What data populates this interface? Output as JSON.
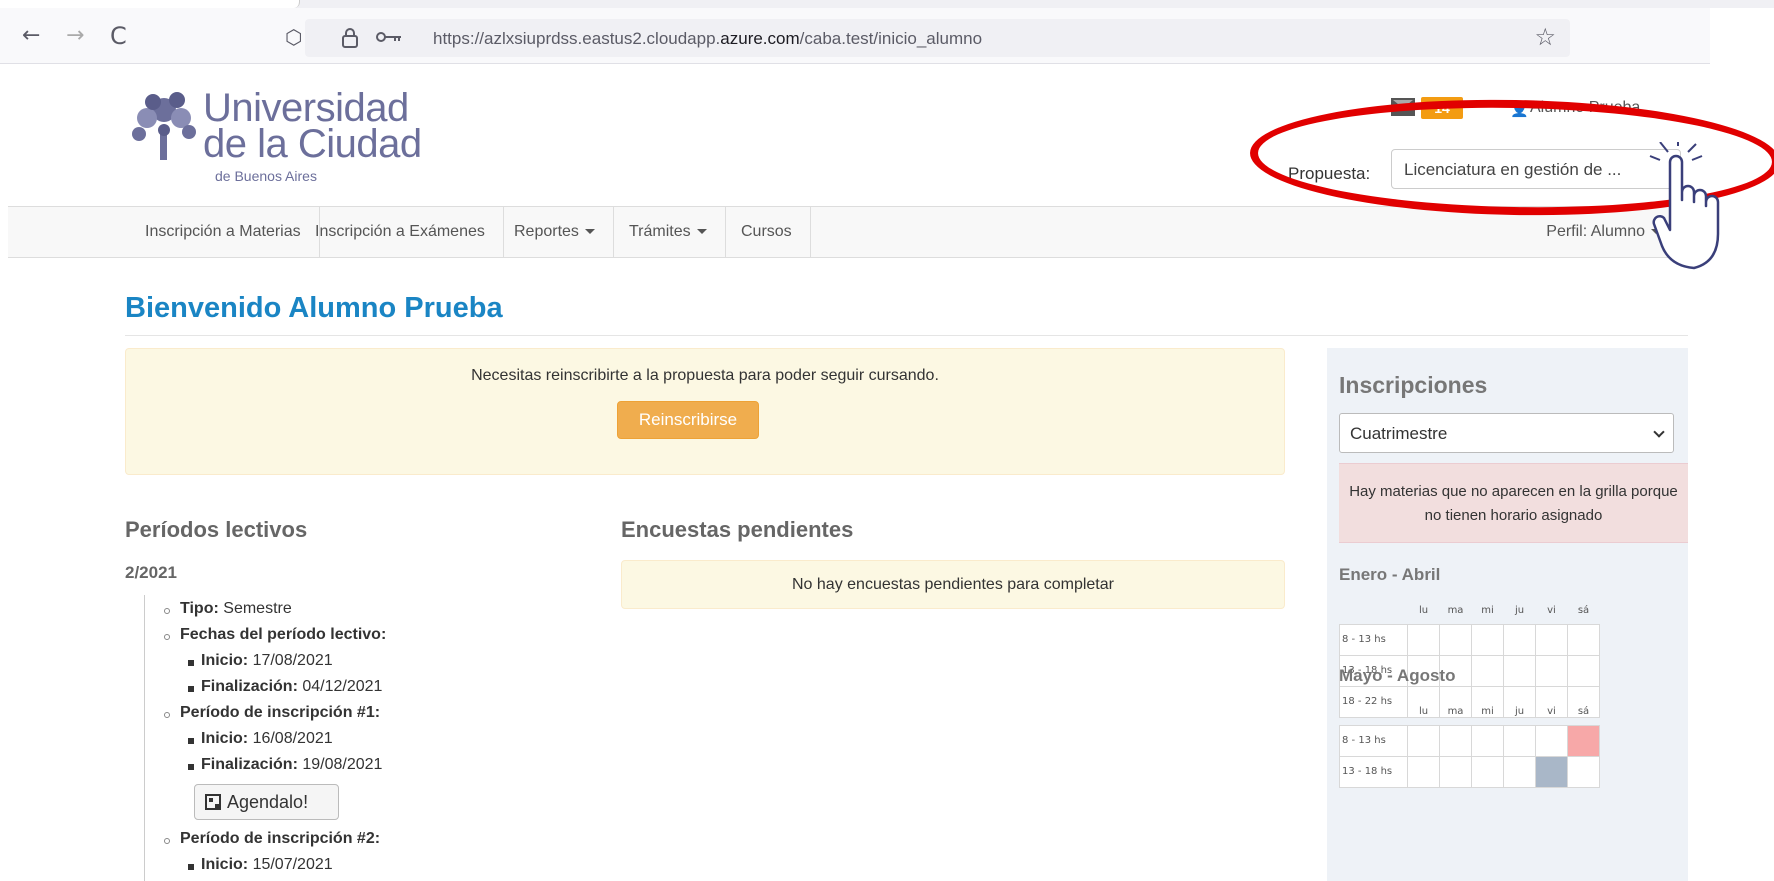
{
  "browser": {
    "back": "←",
    "forward": "→",
    "reload": "C",
    "shield": "⬡",
    "lock": "🔒",
    "key": "⚿",
    "url_prefix": "https://azlxsiuprdss.eastus2.cloudapp.",
    "url_domain": "azure.com",
    "url_suffix": "/caba.test/inicio_alumno",
    "star": "☆"
  },
  "header": {
    "logo_line1": "Universidad",
    "logo_line2": "de la Ciudad",
    "logo_line3": "de Buenos Aires",
    "messages_count": "14",
    "user_name": "Alumno Prueba",
    "propuesta_label": "Propuesta:",
    "propuesta_value": "Licenciatura en gestión de ..."
  },
  "menu": {
    "items": [
      "Inscripción a Materias",
      "Inscripción a Exámenes",
      "Reportes",
      "Trámites",
      "Cursos"
    ],
    "perfil": "Perfil: Alumno"
  },
  "main": {
    "welcome": "Bienvenido Alumno Prueba",
    "reinscripcion_msg": "Necesitas reinscribirte a la propuesta para poder seguir cursando.",
    "reinscribirse_button": "Reinscribirse",
    "periodos_title": "Períodos lectivos",
    "encuestas_title": "Encuestas pendientes",
    "encuestas_msg": "No hay encuestas pendientes para completar",
    "year": "2/2021",
    "tipo_label": "Tipo:",
    "tipo_value": "Semestre",
    "fechas_label": "Fechas del período lectivo:",
    "inicio_label": "Inicio:",
    "finalizacion_label": "Finalización:",
    "fechas_inicio": "17/08/2021",
    "fechas_fin": "04/12/2021",
    "insc1_label": "Período de inscripción #1:",
    "insc1_inicio": "16/08/2021",
    "insc1_fin": "19/08/2021",
    "agendalo_button": "Agendalo!",
    "insc2_label": "Período de inscripción #2:",
    "insc2_inicio": "15/07/2021"
  },
  "sidebar": {
    "title": "Inscripciones",
    "select_value": "Cuatrimestre",
    "warning": "Hay materias que no aparecen en la grilla porque no tienen horario asignado",
    "days": [
      "lu",
      "ma",
      "mi",
      "ju",
      "vi",
      "sá"
    ],
    "period1": {
      "title": "Enero - Abril",
      "rows": [
        "8 - 13 hs",
        "13 - 18 hs",
        "18 - 22 hs"
      ]
    },
    "period2": {
      "title": "Mayo - Agosto",
      "rows": [
        "8 - 13 hs",
        "13 - 18 hs"
      ]
    },
    "colors": {
      "occupied_pink": "#f7a8a8",
      "occupied_blue": "#a9b7c8"
    }
  }
}
